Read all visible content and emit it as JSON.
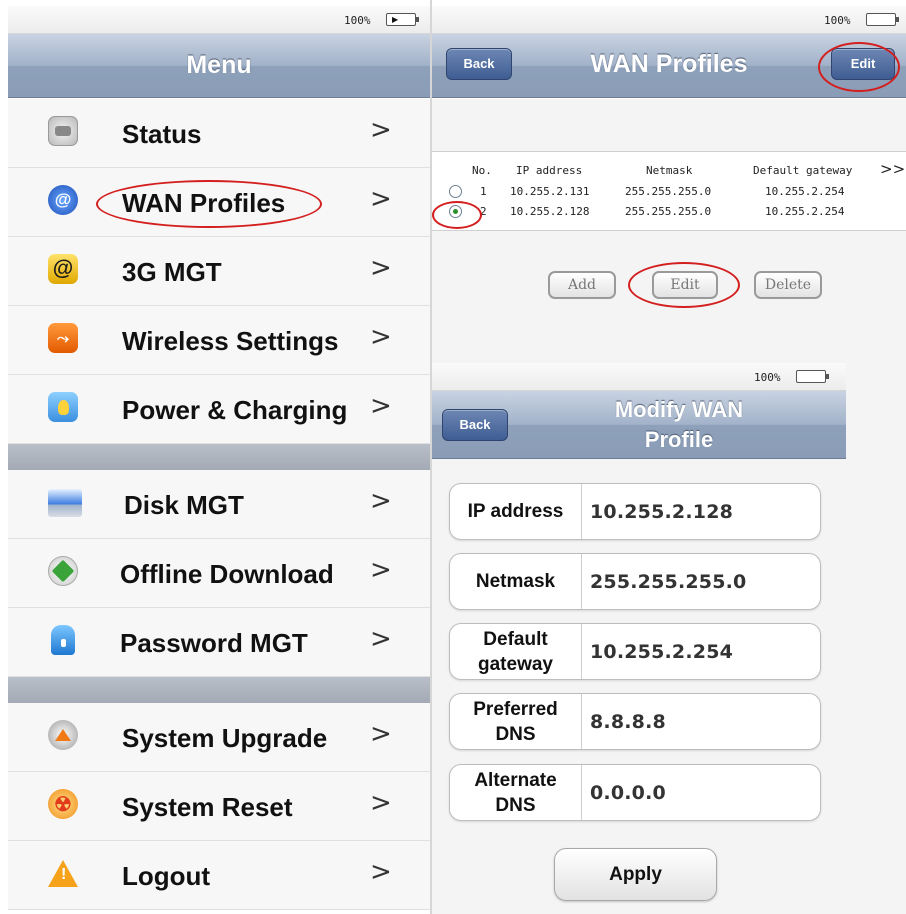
{
  "left_panel": {
    "status_bar": {
      "battery_pct": "100%"
    },
    "title": "Menu",
    "items": [
      {
        "label": "Status",
        "icon": "status-icon",
        "chevron": ">"
      },
      {
        "label": "WAN Profiles",
        "icon": "wan-icon",
        "chevron": ">"
      },
      {
        "label": "3G MGT",
        "icon": "3g-icon",
        "chevron": ">"
      },
      {
        "label": "Wireless Settings",
        "icon": "wireless-icon",
        "chevron": ">"
      },
      {
        "label": "Power & Charging",
        "icon": "power-icon",
        "chevron": ">"
      },
      {
        "label": "Disk MGT",
        "icon": "disk-icon",
        "chevron": ">"
      },
      {
        "label": "Offline Download",
        "icon": "offline-download-icon",
        "chevron": ">"
      },
      {
        "label": "Password MGT",
        "icon": "password-icon",
        "chevron": ">"
      },
      {
        "label": "System Upgrade",
        "icon": "upgrade-icon",
        "chevron": ">"
      },
      {
        "label": "System Reset",
        "icon": "reset-icon",
        "chevron": ">"
      },
      {
        "label": "Logout",
        "icon": "logout-icon",
        "chevron": ">"
      }
    ]
  },
  "wan_panel": {
    "status_bar": {
      "battery_pct": "100%"
    },
    "title": "WAN Profiles",
    "back_label": "Back",
    "edit_label": "Edit",
    "table": {
      "columns": [
        "No.",
        "IP address",
        "Netmask",
        "Default gateway"
      ],
      "more": ">>",
      "rows": [
        {
          "no": "1",
          "ip": "10.255.2.131",
          "mask": "255.255.255.0",
          "gateway": "10.255.2.254",
          "selected": false
        },
        {
          "no": "2",
          "ip": "10.255.2.128",
          "mask": "255.255.255.0",
          "gateway": "10.255.2.254",
          "selected": true
        }
      ]
    },
    "buttons": {
      "add": "Add",
      "edit": "Edit",
      "delete": "Delete"
    }
  },
  "modify_panel": {
    "status_bar": {
      "battery_pct": "100%"
    },
    "title_line1": "Modify WAN",
    "title_line2": "Profile",
    "back_label": "Back",
    "fields": [
      {
        "label_line1": "IP address",
        "label_line2": "",
        "value": "10.255.2.128"
      },
      {
        "label_line1": "Netmask",
        "label_line2": "",
        "value": "255.255.255.0"
      },
      {
        "label_line1": "Default",
        "label_line2": "gateway",
        "value": "10.255.2.254"
      },
      {
        "label_line1": "Preferred",
        "label_line2": "DNS",
        "value": "8.8.8.8"
      },
      {
        "label_line1": "Alternate",
        "label_line2": "DNS",
        "value": "0.0.0.0"
      }
    ],
    "apply_label": "Apply"
  },
  "colors": {
    "annotation_ring": "#d41f1f",
    "nav_bar": "#9aabc3",
    "button_blue": "#3f5d93"
  }
}
